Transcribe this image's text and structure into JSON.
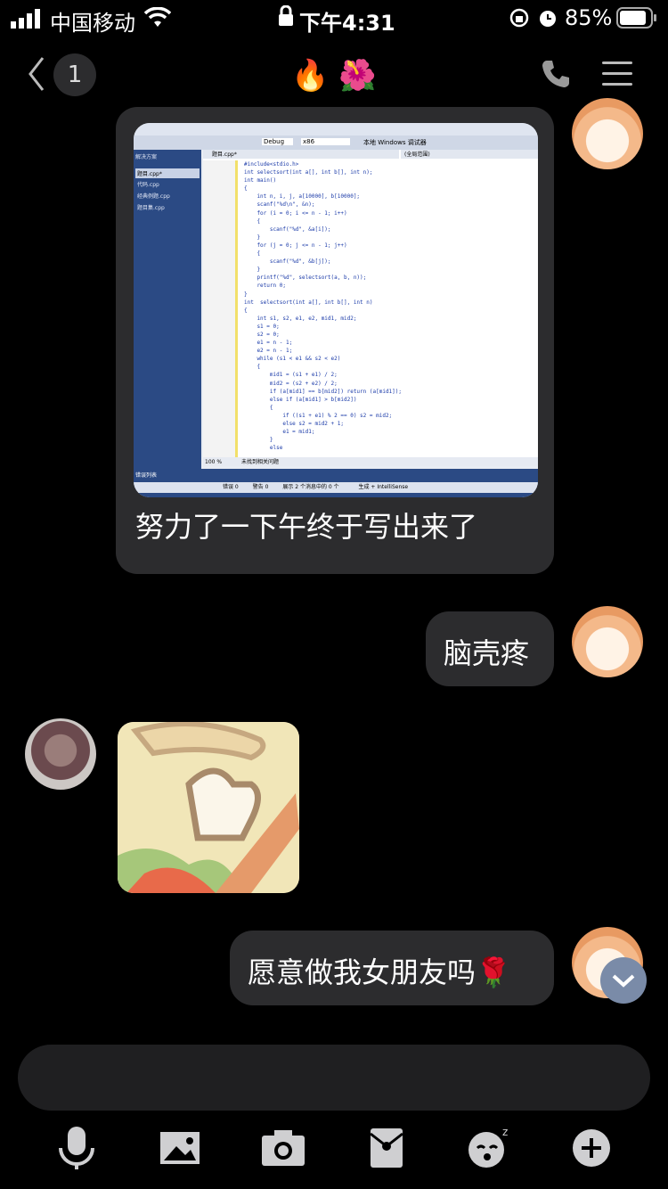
{
  "status_bar": {
    "carrier": "中国移动",
    "time": "下午4:31",
    "battery": "85%"
  },
  "header": {
    "back_count": "1",
    "title": "🔥 🌺"
  },
  "code_screenshot": {
    "toolbar_config": "Debug",
    "toolbar_platform": "x86",
    "toolbar_run": "本地 Windows 调试器",
    "solution_title": "解决方案",
    "files": [
      "题目.cpp*",
      "代码.cpp",
      "经典例题.cpp",
      "题目集.cpp"
    ],
    "file_header": "题目.cpp*",
    "scope": "(全局范围)",
    "code_lines": [
      "#include<stdio.h>",
      "int selectsort(int a[], int b[], int n);",
      "int main()",
      "{",
      "    int n, i, j, a[10000], b[10000];",
      "    scanf(\"%d\\n\", &n);",
      "    for (i = 0; i <= n - 1; i++)",
      "    {",
      "        scanf(\"%d\", &a[i]);",
      "    }",
      "    for (j = 0; j <= n - 1; j++)",
      "    {",
      "        scanf(\"%d\", &b[j]);",
      "    }",
      "    printf(\"%d\", selectsort(a, b, n));",
      "    return 0;",
      "}",
      "int  selectsort(int a[], int b[], int n)",
      "{",
      "    int s1, s2, e1, e2, mid1, mid2;",
      "    s1 = 0;",
      "    s2 = 0;",
      "    e1 = n - 1;",
      "    e2 = n - 1;",
      "    while (s1 < e1 && s2 < e2)",
      "    {",
      "        mid1 = (s1 + e1) / 2;",
      "        mid2 = (s2 + e2) / 2;",
      "        if (a[mid1] == b[mid2]) return (a[mid1]);",
      "        else if (a[mid1] > b[mid2])",
      "        {",
      "            if ((s1 + e1) % 2 == 0) s2 = mid2;",
      "            else s2 = mid2 + 1;",
      "            e1 = mid1;",
      "        }",
      "        else"
    ],
    "zoom": "100 %",
    "no_issues": "未找到相关问题",
    "error_list": "错误列表",
    "errors": "错误 0",
    "warnings": "警告 0",
    "messages": "展示 2 个消息中的 0 个",
    "build": "生成 + IntelliSense"
  },
  "messages": [
    {
      "side": "left",
      "text": "努力了一下午终于写出来了"
    },
    {
      "side": "right",
      "text": "脑壳疼"
    },
    {
      "side": "left",
      "type": "sticker"
    },
    {
      "side": "right",
      "text": "愿意做我女朋友吗🌹"
    }
  ]
}
